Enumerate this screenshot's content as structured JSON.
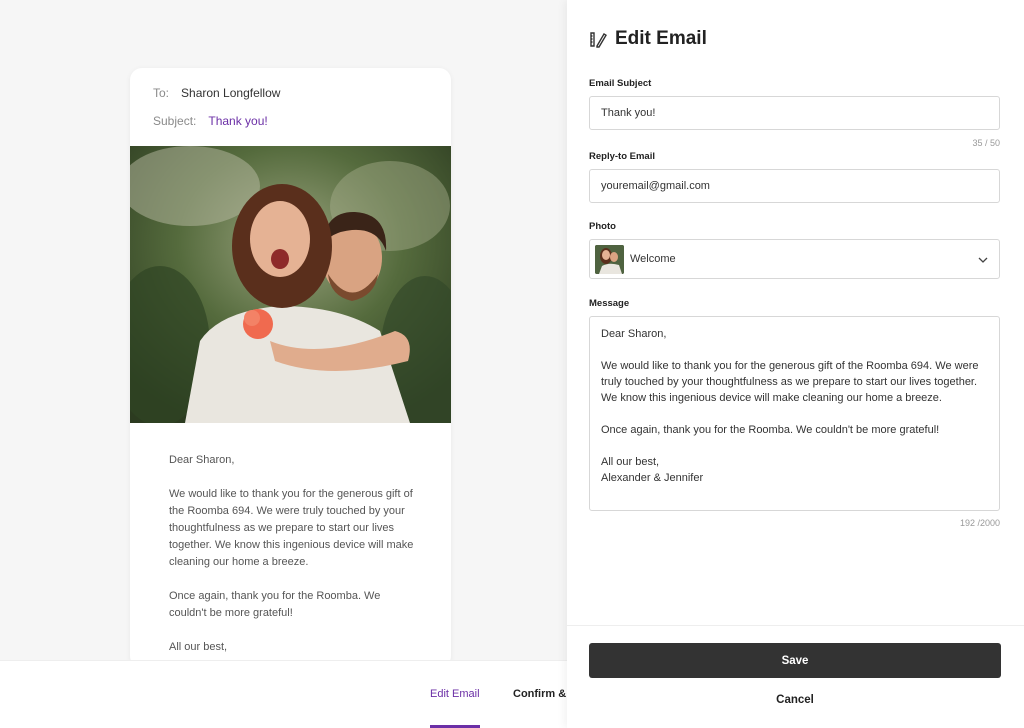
{
  "preview": {
    "to_label": "To:",
    "to_value": "Sharon Longfellow",
    "subject_label": "Subject:",
    "subject_value": "Thank you!",
    "body": [
      "Dear Sharon,",
      "We would like to thank you for the generous gift of the Roomba 694. We were truly touched by your thoughtfulness as we prepare to start our lives together. We know this ingenious device will make cleaning our home a breeze.",
      "Once again, thank you for the Roomba. We couldn't be more grateful!",
      "All our best,"
    ]
  },
  "steps": {
    "edit": "Edit Email",
    "confirm": "Confirm &"
  },
  "panel": {
    "title": "Edit Email",
    "icon": "edit-pencil-ruler-icon",
    "subject_label": "Email Subject",
    "subject_value": "Thank you!",
    "subject_counter": "35 / 50",
    "reply_label": "Reply-to Email",
    "reply_value": "youremail@gmail.com",
    "photo_label": "Photo",
    "photo_value": "Welcome",
    "message_label": "Message",
    "message": [
      "Dear Sharon,",
      "We would like to thank you for the generous gift of the Roomba 694. We were truly touched by your thoughtfulness as we prepare to start our lives together. We know this ingenious device will make cleaning our home a breeze.",
      "Once again, thank you for the Roomba. We couldn't be more grateful!",
      "All our best,\nAlexander & Jennifer"
    ],
    "message_counter": "192 /2000",
    "save_label": "Save",
    "cancel_label": "Cancel"
  },
  "colors": {
    "accent": "#6b2fa6",
    "save_button": "#333333"
  }
}
